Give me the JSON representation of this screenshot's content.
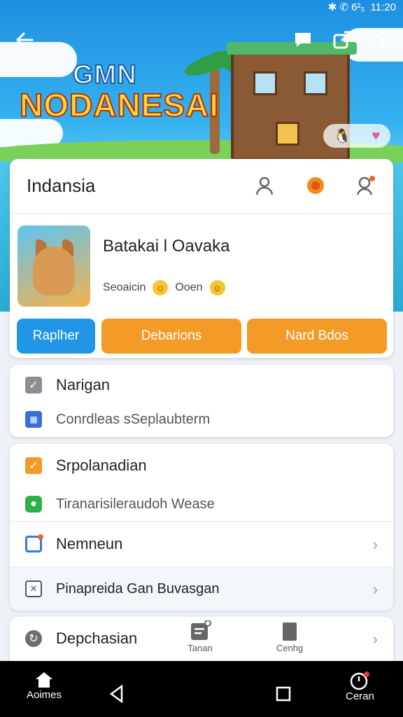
{
  "status": {
    "signal": "✱ ✆ 6²₅",
    "time": "11:20"
  },
  "hero": {
    "logo_top": "GMN",
    "logo_main": "NODANESAI"
  },
  "game_card": {
    "header_title": "Indansia",
    "game_name": "Batakai l Oavaka",
    "sub_left": "Seoaicin",
    "sub_right": "Ooen",
    "buttons": [
      "Raplher",
      "Debarions",
      "Nard Bdos"
    ]
  },
  "section1": {
    "title": "Narigan",
    "subtitle": "Conrdleas sSeplaubterm"
  },
  "section2": {
    "title": "Srpolanadian",
    "subtitle": "Tiranarisileraudoh Wease",
    "item3": "Nemneun",
    "item4": "Pinapreida Gan Buvasgan"
  },
  "section3": {
    "title": "Depchasian"
  },
  "mid_tabs": [
    "Tanan",
    "Cenhg"
  ],
  "nav": {
    "home": "Aoimes",
    "right": "Ceran"
  },
  "colors": {
    "primary_blue": "#2196e6",
    "orange": "#f39a27"
  }
}
